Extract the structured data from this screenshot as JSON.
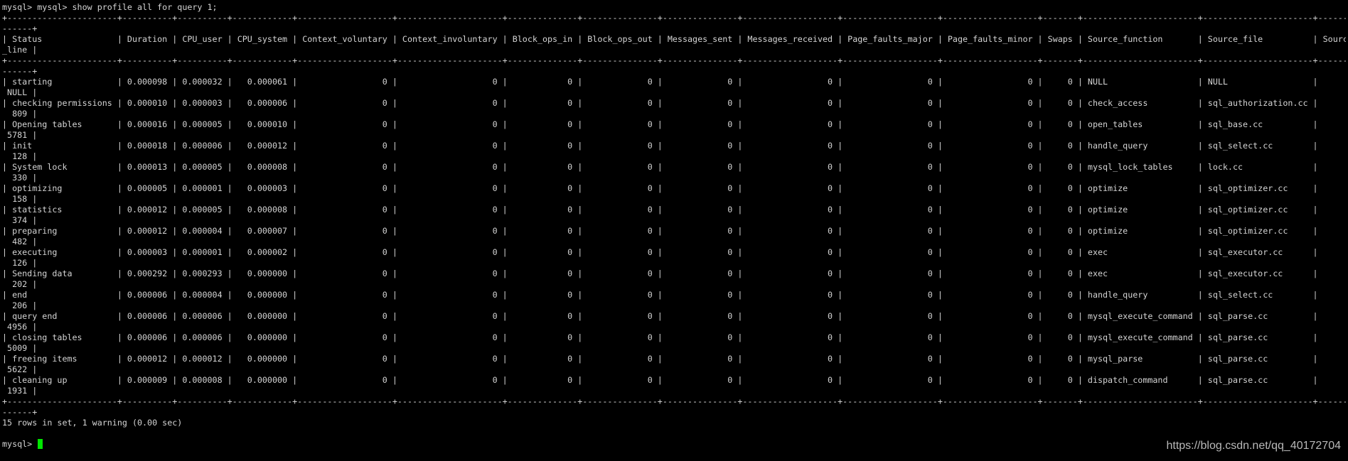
{
  "terminal": {
    "command_line": "mysql> mysql> show profile all for query 1;",
    "border_line": "+----------------------+----------+----------+------------+-------------------+---------------------+--------------+---------------+---------------+-------------------+-------------------+-------------------+-------+-----------------------+----------------------+--------------",
    "border_tail": "------+",
    "header_line": "| Status               | Duration | CPU_user | CPU_system | Context_voluntary | Context_involuntary | Block_ops_in | Block_ops_out | Messages_sent | Messages_received | Page_faults_major | Page_faults_minor | Swaps | Source_function       | Source_file          | Source",
    "header_tail": "_line |",
    "rows": [
      {
        "line": "| starting             | 0.000098 | 0.000032 |   0.000061 |                 0 |                   0 |            0 |             0 |             0 |                 0 |                 0 |                 0 |     0 | NULL                  | NULL                 |",
        "tail": " NULL |"
      },
      {
        "line": "| checking permissions | 0.000010 | 0.000003 |   0.000006 |                 0 |                   0 |            0 |             0 |             0 |                 0 |                 0 |                 0 |     0 | check_access          | sql_authorization.cc |",
        "tail": "  809 |"
      },
      {
        "line": "| Opening tables       | 0.000016 | 0.000005 |   0.000010 |                 0 |                   0 |            0 |             0 |             0 |                 0 |                 0 |                 0 |     0 | open_tables           | sql_base.cc          |",
        "tail": " 5781 |"
      },
      {
        "line": "| init                 | 0.000018 | 0.000006 |   0.000012 |                 0 |                   0 |            0 |             0 |             0 |                 0 |                 0 |                 0 |     0 | handle_query          | sql_select.cc        |",
        "tail": "  128 |"
      },
      {
        "line": "| System lock          | 0.000013 | 0.000005 |   0.000008 |                 0 |                   0 |            0 |             0 |             0 |                 0 |                 0 |                 0 |     0 | mysql_lock_tables     | lock.cc              |",
        "tail": "  330 |"
      },
      {
        "line": "| optimizing           | 0.000005 | 0.000001 |   0.000003 |                 0 |                   0 |            0 |             0 |             0 |                 0 |                 0 |                 0 |     0 | optimize              | sql_optimizer.cc     |",
        "tail": "  158 |"
      },
      {
        "line": "| statistics           | 0.000012 | 0.000005 |   0.000008 |                 0 |                   0 |            0 |             0 |             0 |                 0 |                 0 |                 0 |     0 | optimize              | sql_optimizer.cc     |",
        "tail": "  374 |"
      },
      {
        "line": "| preparing            | 0.000012 | 0.000004 |   0.000007 |                 0 |                   0 |            0 |             0 |             0 |                 0 |                 0 |                 0 |     0 | optimize              | sql_optimizer.cc     |",
        "tail": "  482 |"
      },
      {
        "line": "| executing            | 0.000003 | 0.000001 |   0.000002 |                 0 |                   0 |            0 |             0 |             0 |                 0 |                 0 |                 0 |     0 | exec                  | sql_executor.cc      |",
        "tail": "  126 |"
      },
      {
        "line": "| Sending data         | 0.000292 | 0.000293 |   0.000000 |                 0 |                   0 |            0 |             0 |             0 |                 0 |                 0 |                 0 |     0 | exec                  | sql_executor.cc      |",
        "tail": "  202 |"
      },
      {
        "line": "| end                  | 0.000006 | 0.000004 |   0.000000 |                 0 |                   0 |            0 |             0 |             0 |                 0 |                 0 |                 0 |     0 | handle_query          | sql_select.cc        |",
        "tail": "  206 |"
      },
      {
        "line": "| query end            | 0.000006 | 0.000006 |   0.000000 |                 0 |                   0 |            0 |             0 |             0 |                 0 |                 0 |                 0 |     0 | mysql_execute_command | sql_parse.cc         |",
        "tail": " 4956 |"
      },
      {
        "line": "| closing tables       | 0.000006 | 0.000006 |   0.000000 |                 0 |                   0 |            0 |             0 |             0 |                 0 |                 0 |                 0 |     0 | mysql_execute_command | sql_parse.cc         |",
        "tail": " 5009 |"
      },
      {
        "line": "| freeing items        | 0.000012 | 0.000012 |   0.000000 |                 0 |                   0 |            0 |             0 |             0 |                 0 |                 0 |                 0 |     0 | mysql_parse           | sql_parse.cc         |",
        "tail": " 5622 |"
      },
      {
        "line": "| cleaning up          | 0.000009 | 0.000008 |   0.000000 |                 0 |                   0 |            0 |             0 |             0 |                 0 |                 0 |                 0 |     0 | dispatch_command      | sql_parse.cc         |",
        "tail": " 1931 |"
      }
    ],
    "summary": "15 rows in set, 1 warning (0.00 sec)",
    "prompt": "mysql> "
  },
  "colors": {
    "background": "#000000",
    "text": "#d4d4d4",
    "cursor": "#00e600"
  },
  "watermark": "https://blog.csdn.net/qq_40172704"
}
